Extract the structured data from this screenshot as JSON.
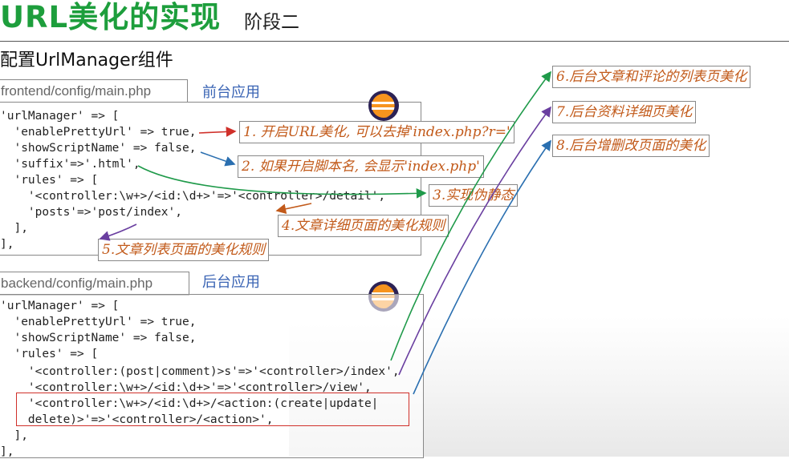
{
  "header": {
    "title": "URL美化的实现",
    "subtitle": "阶段二"
  },
  "section_title": "配置UrlManager组件",
  "frontend": {
    "path": "frontend/config/main.php",
    "app_label": "前台应用",
    "code": [
      "'urlManager' => [",
      "  'enablePrettyUrl' => true,",
      "  'showScriptName' => false,",
      "  'suffix'=>'.html',",
      "  'rules' => [",
      "    '<controller:\\w+>/<id:\\d+>'=>'<controller>/detail',",
      "    'posts'=>'post/index',",
      "  ],",
      "],"
    ]
  },
  "backend": {
    "path": "backend/config/main.php",
    "app_label": "后台应用",
    "code": [
      "'urlManager' => [",
      "  'enablePrettyUrl' => true,",
      "  'showScriptName' => false,",
      "  'rules' => [",
      "    '<controller:(post|comment)>s'=>'<controller>/index',",
      "    '<controller:\\w+>/<id:\\d+>'=>'<controller>/view',",
      "    '<controller:\\w+>/<id:\\d+>/<action:(create|update|",
      "    delete)>'=>'<controller>/<action>',",
      "  ],",
      "],"
    ]
  },
  "notes": {
    "n1": "1. 开启URL美化, 可以去掉'index.php?r='",
    "n2": "2. 如果开启脚本名, 会显示'index.php'",
    "n3": "3.实现伪静态",
    "n4": "4.文章详细页面的美化规则",
    "n5": "5.文章列表页面的美化规则",
    "n6": "6.后台文章和评论的列表页美化",
    "n7": "7.后台资料详细页美化",
    "n8": "8.后台增删改页面的美化"
  },
  "colors": {
    "title_green": "#1d9e3c",
    "app_label_blue": "#3a64b4",
    "note_orange": "#c25a1a",
    "arrow_red": "#d0302a",
    "arrow_blue": "#2a6fb0",
    "arrow_green": "#1f9a4a",
    "arrow_purple": "#6a3fa0"
  },
  "icons": [
    "eclipse-icon",
    "eclipse-icon"
  ]
}
